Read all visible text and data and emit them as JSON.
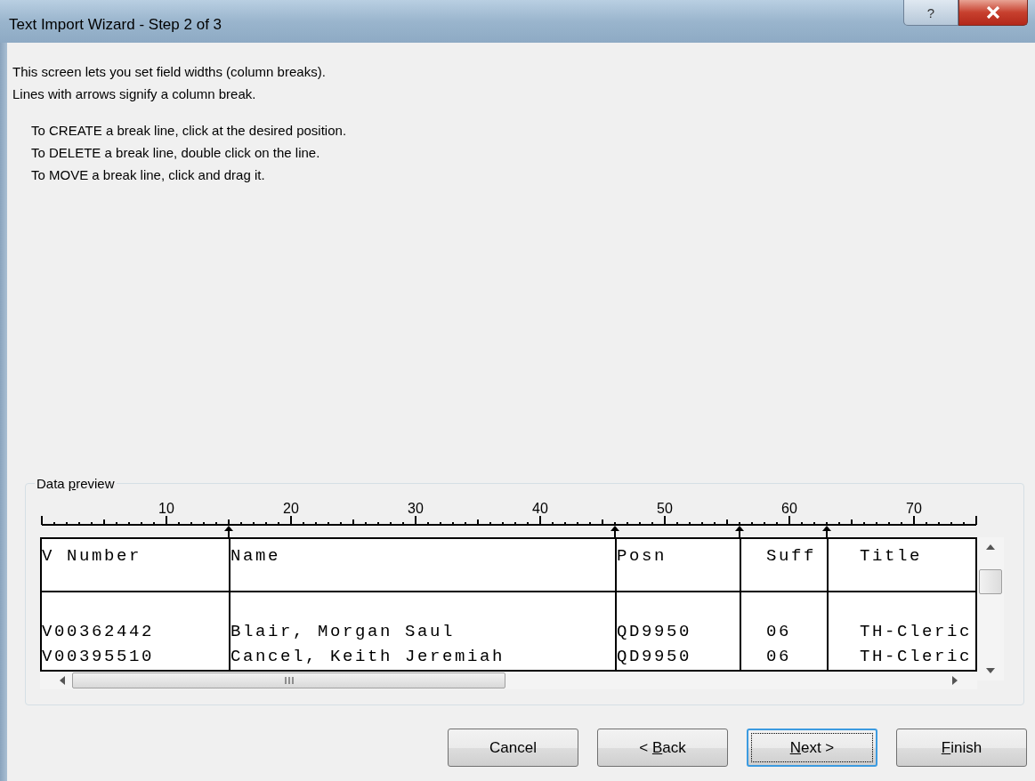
{
  "window": {
    "title": "Text Import Wizard - Step 2 of 3",
    "help_button": "?"
  },
  "intro": [
    "This screen lets you set field widths (column breaks).",
    "Lines with arrows signify a column break."
  ],
  "instructions": [
    "To CREATE a break line, click at the desired position.",
    "To DELETE a break line, double click on the line.",
    "To MOVE a break line, click and drag it."
  ],
  "data_preview": {
    "legend": {
      "label_before": "Data ",
      "access_key": "p",
      "label_after": "review"
    },
    "ruler_labels": [
      "10",
      "20",
      "30",
      "40",
      "50",
      "60",
      "70"
    ],
    "columns": [
      {
        "header": "V Number",
        "cells": [
          "V00362442",
          "V00395510"
        ]
      },
      {
        "header": "Name",
        "cells": [
          "Blair, Morgan Saul",
          "Cancel, Keith Jeremiah"
        ]
      },
      {
        "header": "Posn",
        "cells": [
          "QD9950",
          "QD9950"
        ]
      },
      {
        "header": "Suff",
        "cells": [
          "06",
          "06"
        ]
      },
      {
        "header": "Title",
        "cells": [
          "TH-Cleric",
          "TH-Cleric"
        ]
      }
    ]
  },
  "buttons": [
    {
      "label_before": "Cancel",
      "focused": false
    },
    {
      "label_before": "< ",
      "access_key": "B",
      "label_after": "ack",
      "focused": false
    },
    {
      "access_key": "N",
      "label_after": "ext >",
      "focused": true
    },
    {
      "access_key": "F",
      "label_after": "inish",
      "focused": false
    }
  ]
}
